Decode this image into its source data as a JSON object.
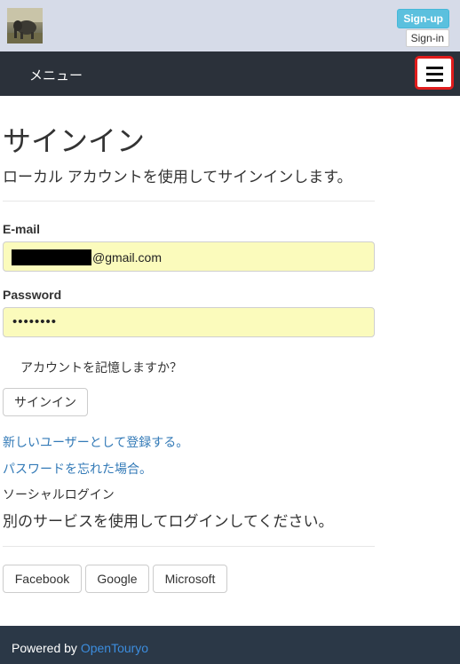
{
  "header": {
    "signup_label": "Sign-up",
    "signin_label": "Sign-in"
  },
  "navbar": {
    "menu_label": "メニュー",
    "toggle_icon": "hamburger-menu-icon"
  },
  "page": {
    "title": "サインイン",
    "lead": "ローカル アカウントを使用してサインインします。"
  },
  "form": {
    "email_label": "E-mail",
    "email_value_suffix": "@gmail.com",
    "password_label": "Password",
    "password_mask": "••••••••",
    "remember_label": "アカウントを記憶しますか？",
    "submit_label": "サインイン"
  },
  "links": {
    "register": "新しいユーザーとして登録する。",
    "forgot": "パスワードを忘れた場合。"
  },
  "social": {
    "title": "ソーシャルログイン",
    "lead": "別のサービスを使用してログインしてください。",
    "providers": [
      "Facebook",
      "Google",
      "Microsoft"
    ]
  },
  "footer": {
    "prefix": "Powered by",
    "link_label": "OpenTouryo"
  },
  "colors": {
    "navbar_bg": "#2b313a",
    "topbar_bg": "#d6dbe8",
    "autofill_bg": "#fbfbbc",
    "link": "#337ab7",
    "signup_btn": "#5bc0de",
    "toggle_highlight": "#e01c1c",
    "footer_bg": "#2b3847"
  }
}
